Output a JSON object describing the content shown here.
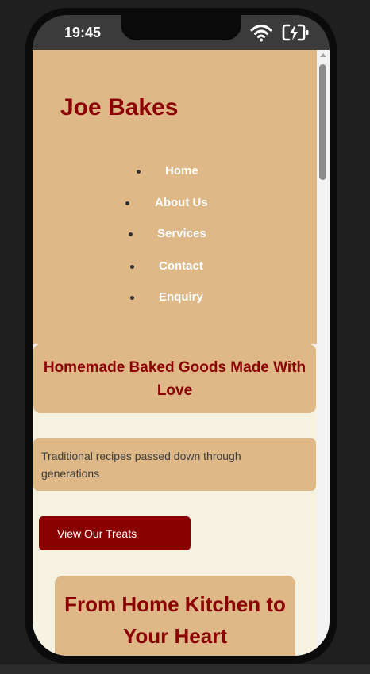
{
  "status_bar": {
    "time": "19:45",
    "icons": [
      "wifi-icon",
      "battery-charging-icon"
    ]
  },
  "site": {
    "title": "Joe Bakes",
    "nav": [
      {
        "label": "Home"
      },
      {
        "label": "About Us"
      },
      {
        "label": "Services"
      },
      {
        "label": "Contact"
      },
      {
        "label": "Enquiry"
      }
    ]
  },
  "hero": {
    "heading": "Homemade Baked Goods Made With Love"
  },
  "tagline": {
    "text": "Traditional recipes passed down through generations"
  },
  "cta": {
    "label": "View Our Treats"
  },
  "promo": {
    "heading": "From Home Kitchen to Your Heart"
  },
  "colors": {
    "accent": "#8b0000",
    "tan": "#deb887",
    "cream": "#f5f2e1",
    "nav_text": "#ffffff"
  }
}
